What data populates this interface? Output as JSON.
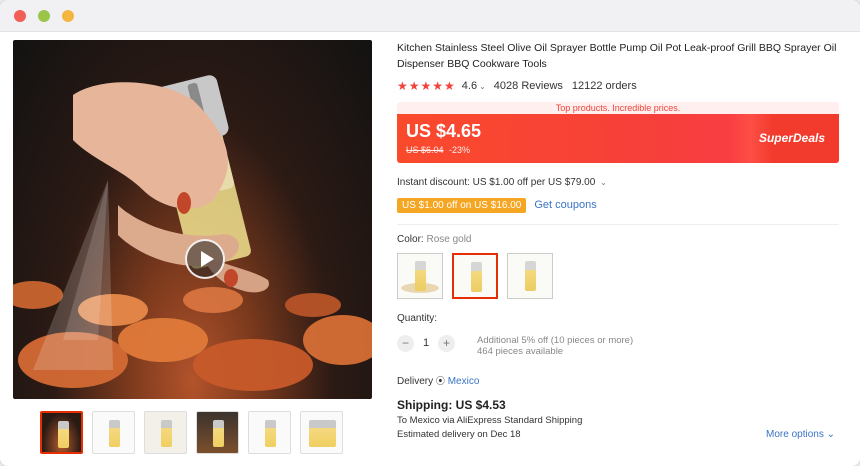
{
  "window": {
    "buttons": [
      "close",
      "minimize",
      "maximize"
    ]
  },
  "media": {
    "thumbnail_count": 6,
    "active_thumbnail": 1,
    "play_icon": "play-icon"
  },
  "product": {
    "title": "Kitchen Stainless Steel Olive Oil Sprayer Bottle Pump Oil Pot Leak-proof Grill BBQ Sprayer Oil Dispenser BBQ Cookware Tools",
    "stars": "★★★★★",
    "rating": "4.6",
    "reviews": "4028 Reviews",
    "orders": "12122 orders"
  },
  "deal": {
    "tagline": "Top products. Incredible prices.",
    "price": "US $4.65",
    "old_price": "US $6.04",
    "discount": "-23%",
    "brand": "SuperDeals",
    "colors": {
      "banner": "#f63f3b",
      "tag": "#f5a623",
      "link": "#3a74c6",
      "accent": "#e62e04"
    }
  },
  "discounts": {
    "instant": "Instant discount: US $1.00 off per US $79.00",
    "coupon_tag": "US $1.00 off on US $16.00",
    "get_coupons": "Get coupons"
  },
  "color": {
    "label": "Color:",
    "value": "Rose gold",
    "swatch_count": 3,
    "selected_index": 1
  },
  "quantity": {
    "label": "Quantity:",
    "value": "1",
    "minus": "−",
    "plus": "+",
    "note_line1": "Additional 5% off (10 pieces or more)",
    "note_line2": "464 pieces available"
  },
  "delivery": {
    "label": "Delivery",
    "country": "Mexico"
  },
  "shipping": {
    "title": "Shipping: US $4.53",
    "via": "To Mexico via AliExpress Standard Shipping",
    "estimate": "Estimated delivery on Dec 18",
    "more_options": "More options"
  }
}
